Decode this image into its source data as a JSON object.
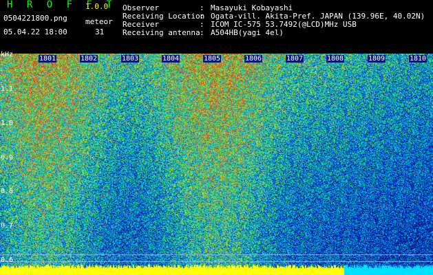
{
  "header": {
    "app_title": "H R O F F T",
    "version": "1.0.0",
    "filename": "0504221800.png",
    "mode": "meteor",
    "datetime": "05.04.22 18:00",
    "count": "31"
  },
  "metadata": [
    {
      "key": "Observer",
      "value": "Masayuki Kobayashi"
    },
    {
      "key": "Receiving Location",
      "value": "Ogata-vill. Akita-Pref. JAPAN (139.96E, 40.02N)"
    },
    {
      "key": "Receiver",
      "value": "ICOM IC-575 53.7492(@LCD)MHz USB"
    },
    {
      "key": "Receiving antenna",
      "value": "A504HB(yagi 4el)"
    }
  ],
  "spectrogram": {
    "y_unit": "kHz",
    "y_ticks": [
      "1.1",
      "1.0",
      "0.9",
      "0.8",
      "0.7",
      "0.6"
    ],
    "x_ticks": [
      "1801",
      "1802",
      "1803",
      "1804",
      "1805",
      "1806",
      "1807",
      "1808",
      "1809",
      "1810"
    ]
  },
  "colors": {
    "background": "#000000",
    "label": "#ffff00",
    "bar": "#ffff00"
  }
}
